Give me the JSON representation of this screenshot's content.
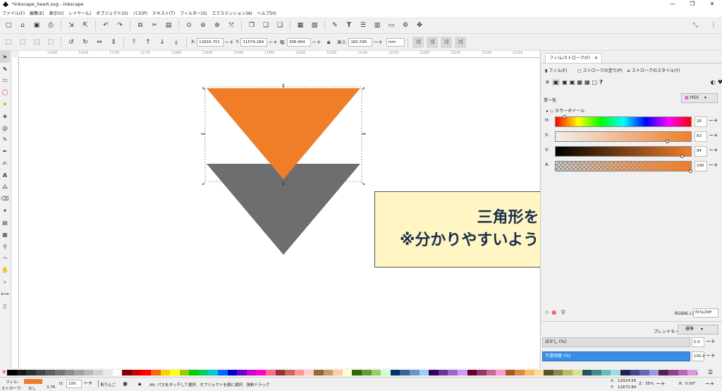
{
  "window": {
    "title": "*inkscape_heart.svg - Inkscape",
    "minimize": "—",
    "maximize": "❐",
    "close": "✕"
  },
  "menu": [
    "ファイル(F)",
    "編集(E)",
    "表示(V)",
    "レイヤー(L)",
    "オブジェクト(O)",
    "パス(P)",
    "テキスト(T)",
    "フィルター(S)",
    "エクステンション(N)",
    "ヘルプ(H)"
  ],
  "toolcontrols": {
    "x_label": "X:",
    "x_value": "11816.701",
    "y_label": "Y:",
    "y_value": "11574.184",
    "w_label": "幅:",
    "w_value": "306.464",
    "h_label": "高さ:",
    "h_value": "182.338",
    "unit": "mm"
  },
  "ruler": {
    "labels": [
      "11600",
      "11650",
      "11700",
      "11750",
      "11800",
      "11850",
      "11900",
      "11950",
      "12000",
      "12050",
      "12100",
      "12150",
      "12200",
      "12250",
      "12300",
      "12350",
      "12400"
    ]
  },
  "panel": {
    "tab_title": "フィル/ストローク(F)",
    "tab_close": "✕",
    "subtabs": {
      "fill": "フィル(F)",
      "stroke_paint": "ストロークの塗り(P)",
      "stroke_style": "ストロークのスタイル(Y)"
    },
    "flat_label": "単一色",
    "mode": "HSV",
    "wheel_label": "カラーホイール",
    "sliders": [
      {
        "label": "H:",
        "value": "26",
        "pos": 0.07
      },
      {
        "label": "S:",
        "value": "83",
        "pos": 0.83
      },
      {
        "label": "V:",
        "value": "94",
        "pos": 0.94
      },
      {
        "label": "A:",
        "value": "100",
        "pos": 1.0
      }
    ],
    "rgba_label": "RGBA(↓):",
    "rgba_value": "f07e29ff",
    "blend_label": "ブレンドモード:",
    "blend_value": "標準",
    "blur_label": "ぼかし (%)",
    "blur_value": "0.0",
    "opacity_label": "不透明度 (%)",
    "opacity_value": "100.0"
  },
  "callout": {
    "line1": "三角形をコピペ",
    "line2": "※分かりやすいようにオレンジに着色"
  },
  "colors": {
    "orange": "#f07e29",
    "gray": "#6e6d70",
    "accent_blue": "#3a8ee6"
  },
  "status": {
    "fill_label": "フィル:",
    "stroke_label": "ストローク:",
    "stroke_value": "なし",
    "stroke_width": "3.76",
    "opacity_label": "O:",
    "opacity_value": "100",
    "layer": "青りんご",
    "message": "Alt: パスをタッチして選択、オブジェクトを順に選択、強制ドラッグ",
    "x_label": "X:",
    "x": "12024.56",
    "y_label": "Y:",
    "y": "11672.84",
    "zoom_label": "Z:",
    "zoom": "35%",
    "rot_label": "R:",
    "rotation": "0.00°"
  }
}
